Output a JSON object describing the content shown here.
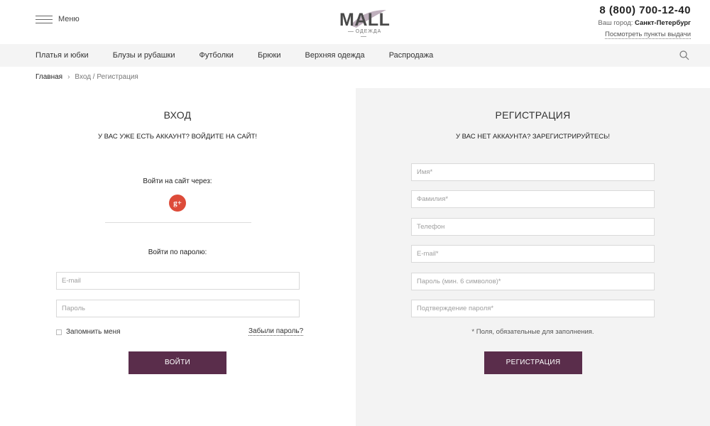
{
  "header": {
    "menu_label": "Меню",
    "logo_text": "MALL",
    "logo_sub": "ОДЕЖДА",
    "phone": "8 (800) 700-12-40",
    "city_label": "Ваш город:",
    "city_value": "Санкт-Петербург",
    "pickup_link": "Посмотреть пункты выдачи"
  },
  "nav": {
    "items": [
      {
        "label": "Платья и юбки"
      },
      {
        "label": "Блузы и рубашки"
      },
      {
        "label": "Футболки"
      },
      {
        "label": "Брюки"
      },
      {
        "label": "Верхняя одежда"
      },
      {
        "label": "Распродажа"
      }
    ],
    "search_icon": "search-icon"
  },
  "breadcrumb": {
    "home": "Главная",
    "separator": "›",
    "current": "Вход / Регистрация"
  },
  "login": {
    "title": "ВХОД",
    "subtitle": "У ВАС УЖЕ ЕСТЬ АККАУНТ? ВОЙДИТЕ НА САЙТ!",
    "social_label": "Войти на сайт через:",
    "gplus_icon": "g+",
    "password_label": "Войти по паролю:",
    "email_placeholder": "E-mail",
    "password_placeholder": "Пароль",
    "remember_label": "Запомнить меня",
    "forgot_label": "Забыли пароль?",
    "submit_label": "ВОЙТИ"
  },
  "register": {
    "title": "РЕГИСТРАЦИЯ",
    "subtitle": "У ВАС НЕТ АККАУНТА? ЗАРЕГИСТРИРУЙТЕСЬ!",
    "fields": [
      {
        "placeholder": "Имя*"
      },
      {
        "placeholder": "Фамилия*"
      },
      {
        "placeholder": "Телефон"
      },
      {
        "placeholder": "E-mail*"
      },
      {
        "placeholder": "Пароль (мин. 6 символов)*"
      },
      {
        "placeholder": "Подтверждение пароля*"
      }
    ],
    "required_note": "* Поля, обязательные для заполнения.",
    "submit_label": "РЕГИСТРАЦИЯ"
  },
  "colors": {
    "accent": "#5a2d4b",
    "gplus": "#dd4b39",
    "nav_bg": "#f4f4f4",
    "panel_bg": "#f3f3f3"
  }
}
